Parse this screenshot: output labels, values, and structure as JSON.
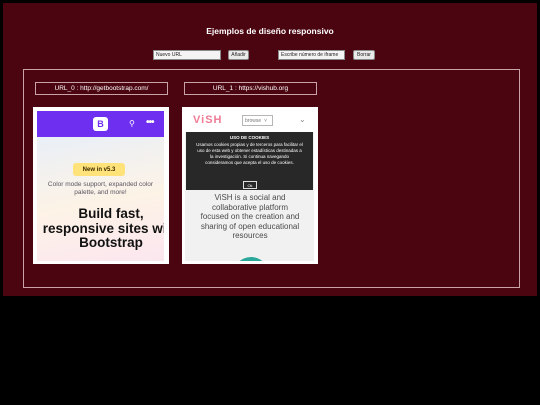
{
  "page": {
    "title": "Ejemplos de diseño responsivo"
  },
  "toolbar": {
    "url_placeholder": "Nuevo URL",
    "add_label": "Añadir",
    "iframe_count_placeholder": "Escribe número de iframe",
    "delete_label": "Borrar"
  },
  "frames": [
    {
      "header": "URL_0 : http://getbootstrap.com/",
      "preview": {
        "logo": "B",
        "search_icon": "search-icon",
        "more_icon": "more-icon",
        "badge": "New in v5.3",
        "subtitle": "Color mode support, expanded color palette, and more!",
        "headline": "Build fast, responsive sites with Bootstrap"
      }
    },
    {
      "header": "URL_1 : https://vishub.org",
      "preview": {
        "logo": "ViSH",
        "browse": "browse",
        "cookie_title": "USO DE COOKIES",
        "cookie_text": "Usamos cookies propias y de terceros para facilitar el uso de esta web y obtener estadísticas destinadas a la investigación. Si continua navegando consideramos que acepta el uso de cookies.",
        "cookie_ok": "Ok",
        "body_text": "ViSH is a social and collaborative platform focused on the creation and sharing of open educational resources"
      }
    }
  ]
}
